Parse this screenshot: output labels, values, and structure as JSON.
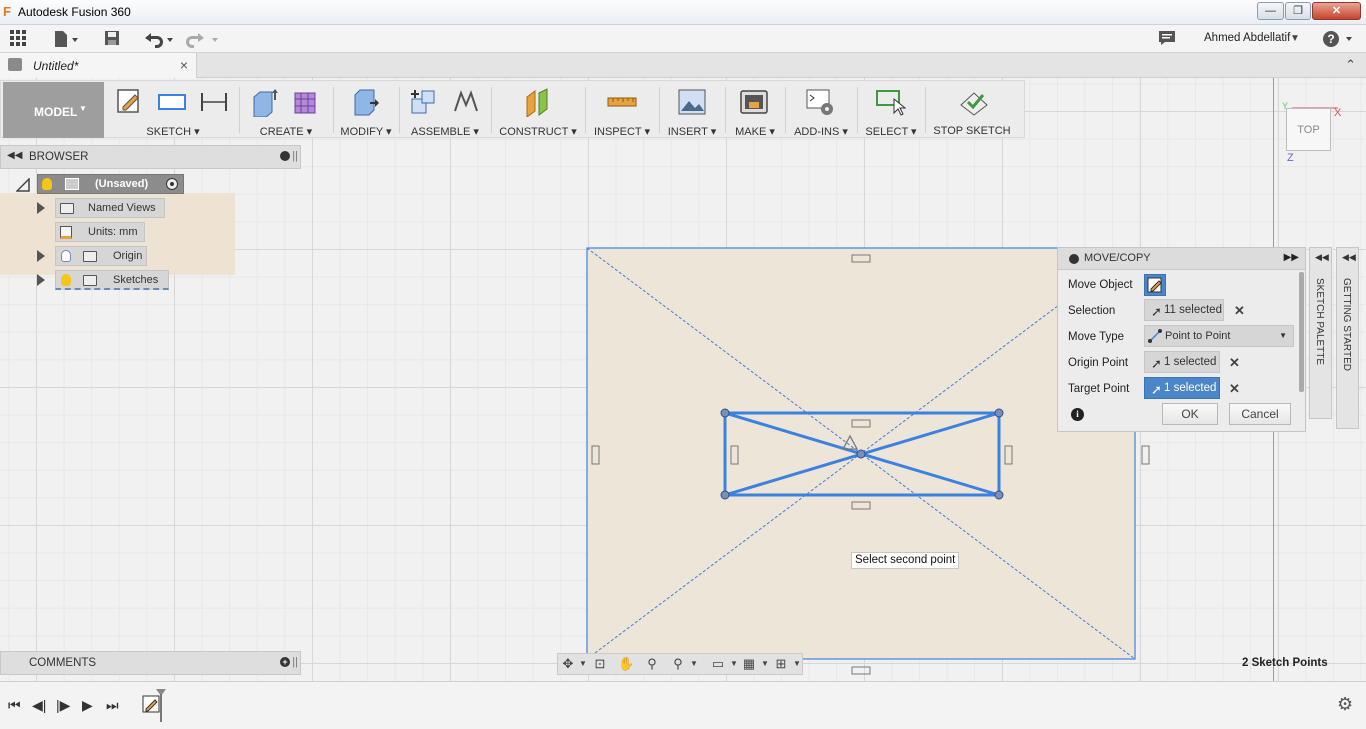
{
  "window": {
    "title": "Autodesk Fusion 360",
    "app_letter": "F",
    "min": "—",
    "restore": "❐",
    "close": "✕"
  },
  "appbar": {
    "user": "Ahmed Abdellatif",
    "help": "?"
  },
  "document": {
    "tab_title": "Untitled*",
    "close": "×"
  },
  "toolbar": {
    "workspace": "MODEL",
    "groups": [
      {
        "label": "SKETCH"
      },
      {
        "label": "CREATE"
      },
      {
        "label": "MODIFY"
      },
      {
        "label": "ASSEMBLE"
      },
      {
        "label": "CONSTRUCT"
      },
      {
        "label": "INSPECT"
      },
      {
        "label": "INSERT"
      },
      {
        "label": "MAKE"
      },
      {
        "label": "ADD-INS"
      },
      {
        "label": "SELECT"
      },
      {
        "label": "STOP SKETCH"
      }
    ]
  },
  "browser": {
    "title": "BROWSER",
    "root": "(Unsaved)",
    "items": [
      {
        "label": "Named Views"
      },
      {
        "label": "Units: mm"
      },
      {
        "label": "Origin"
      },
      {
        "label": "Sketches"
      }
    ]
  },
  "comments": {
    "title": "COMMENTS"
  },
  "viewcube": {
    "face": "TOP",
    "axis_x": "X",
    "axis_z": "Z"
  },
  "dialog": {
    "title": "MOVE/COPY",
    "rows": {
      "move_object": "Move Object",
      "selection": "Selection",
      "selection_value": "11 selected",
      "move_type": "Move Type",
      "move_type_value": "Point to Point",
      "origin_point": "Origin Point",
      "origin_value": "1 selected",
      "target_point": "Target Point",
      "target_value": "1 selected"
    },
    "ok": "OK",
    "cancel": "Cancel"
  },
  "side_tabs": {
    "sketch_palette": "SKETCH PALETTE",
    "getting_started": "GETTING STARTED"
  },
  "canvas": {
    "tooltip": "Select second point"
  },
  "status": {
    "sketch_points": "2 Sketch Points"
  },
  "colors": {
    "sketch_blue": "#3b82e0",
    "selection_blue": "#4a86c8",
    "sheet_fill": "#eee5d9",
    "axis_green": "#5cc85c"
  }
}
